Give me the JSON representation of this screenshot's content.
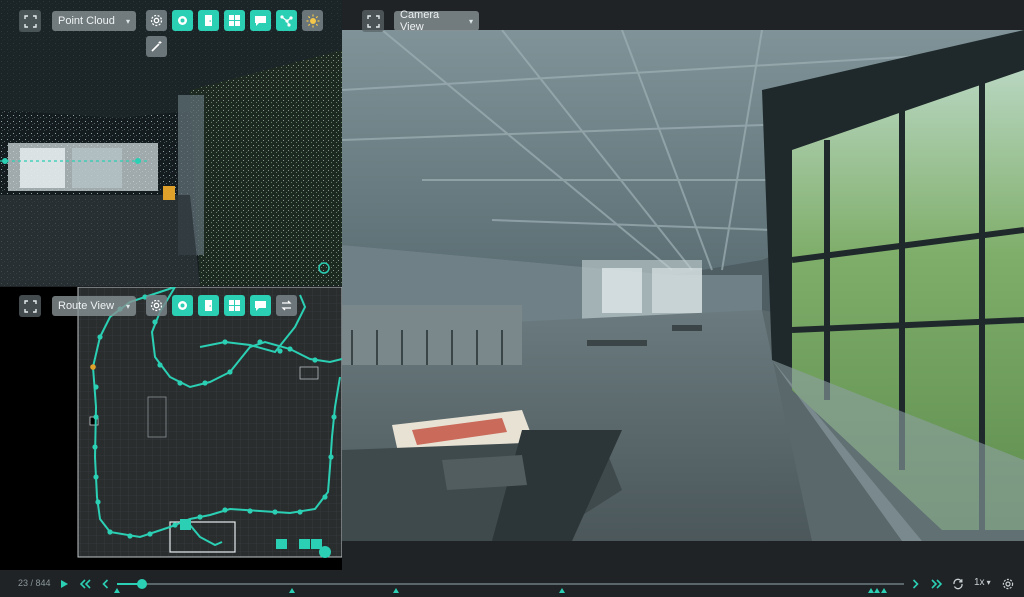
{
  "point_cloud": {
    "view_select": "Point Cloud",
    "tools": [
      "gear-icon",
      "location-pin-icon",
      "door-icon",
      "floor-grid-icon",
      "comment-icon",
      "route-nodes-icon",
      "brightness-icon",
      "magic-wand-icon"
    ]
  },
  "route_view": {
    "view_select": "Route View",
    "tools": [
      "gear-icon",
      "location-pin-icon",
      "door-icon",
      "floor-grid-icon",
      "comment-icon",
      "swap-icon"
    ]
  },
  "camera_view": {
    "view_select": "Camera View"
  },
  "timeline": {
    "frame_counter": "23 / 844",
    "progress": 0.032,
    "speed": "1x",
    "marker_positions": [
      0.0,
      0.222,
      0.354,
      0.566,
      0.958,
      0.966,
      0.975
    ]
  },
  "colors": {
    "accent": "#2bd0b4",
    "background": "#202326"
  }
}
